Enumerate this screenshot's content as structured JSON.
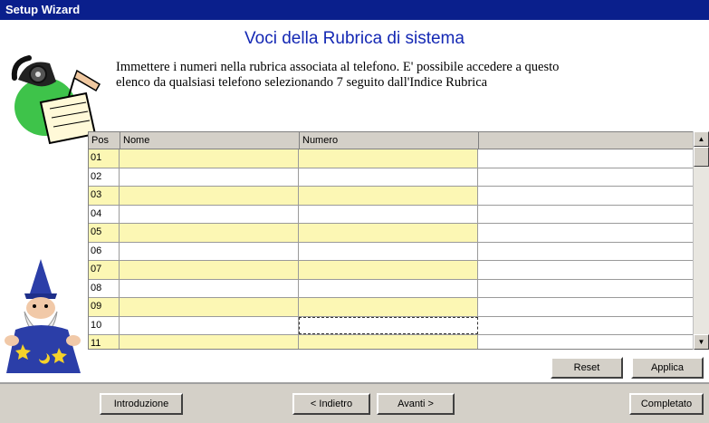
{
  "window": {
    "title": "Setup Wizard"
  },
  "page": {
    "heading": "Voci della Rubrica di sistema",
    "description": "Immettere i numeri nella rubrica associata al telefono. E' possibile accedere a questo elenco da qualsiasi telefono selezionando 7 seguito dall'Indice Rubrica"
  },
  "grid": {
    "columns": [
      "Pos",
      "Nome",
      "Numero"
    ],
    "rows": [
      {
        "pos": "01"
      },
      {
        "pos": "02"
      },
      {
        "pos": "03"
      },
      {
        "pos": "04"
      },
      {
        "pos": "05"
      },
      {
        "pos": "06"
      },
      {
        "pos": "07"
      },
      {
        "pos": "08"
      },
      {
        "pos": "09"
      },
      {
        "pos": "10"
      },
      {
        "pos": "11"
      }
    ]
  },
  "buttons": {
    "reset": "Reset",
    "applica": "Applica",
    "introduzione": "Introduzione",
    "indietro": "< Indietro",
    "avanti": "Avanti >",
    "completato": "Completato"
  },
  "colors": {
    "titlebar": "#0a1f8c",
    "heading": "#1428b4",
    "row_highlight": "#fcf7b4"
  },
  "icons": {
    "phone": "telephone-notebook-icon",
    "wizard": "wizard-mascot-icon",
    "scroll_up": "arrow-up-icon",
    "scroll_down": "arrow-down-icon"
  }
}
